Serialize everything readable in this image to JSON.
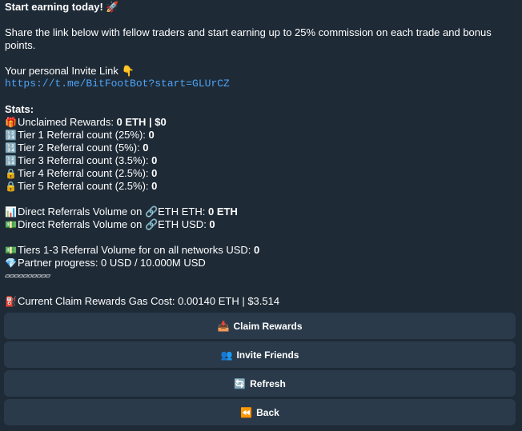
{
  "message": {
    "title": "Start earning today! 🚀",
    "intro": "Share the link below with fellow traders and start earning up to 25% commission on each trade and bonus points.",
    "invite_label": "Your personal Invite Link 👇",
    "invite_link": "https://t.me/BitFootBot?start=GLUrCZ",
    "stats_header": "Stats:",
    "unclaimed_label": "Unclaimed Rewards: ",
    "unclaimed_value": "0 ETH | $0",
    "tiers": [
      {
        "icon": "🔢",
        "label": "Tier 1 Referral count (25%): ",
        "value": "0"
      },
      {
        "icon": "🔢",
        "label": "Tier 2 Referral count (5%): ",
        "value": "0"
      },
      {
        "icon": "🔢",
        "label": "Tier 3 Referral count (3.5%): ",
        "value": "0"
      },
      {
        "icon": "🔒",
        "label": "Tier 4 Referral count (2.5%): ",
        "value": "0"
      },
      {
        "icon": "🔒",
        "label": "Tier 5 Referral count (2.5%): ",
        "value": "0"
      }
    ],
    "volume_eth_label": "Direct Referrals Volume on 🔗ETH ETH: ",
    "volume_eth_value": "0 ETH",
    "volume_usd_label": "Direct Referrals Volume on 🔗ETH USD: ",
    "volume_usd_value": "0",
    "tiers_volume_label": "Tiers 1-3 Referral Volume for on all networks USD: ",
    "tiers_volume_value": "0",
    "partner_progress": "Partner progress: 0 USD / 10.000M USD",
    "progress_bar": "▱▱▱▱▱▱▱▱▱▱",
    "gas_cost": "Current Claim Rewards Gas Cost: 0.00140 ETH | $3.514"
  },
  "icons": {
    "gift": "🎁",
    "chart": "📊",
    "money": "💵",
    "diamond": "💎",
    "fuel": "⛽",
    "inbox": "📥",
    "people": "👥",
    "refresh": "🔄",
    "back": "⏪"
  },
  "buttons": {
    "claim": "Claim Rewards",
    "invite": "Invite Friends",
    "refresh": "Refresh",
    "back": "Back"
  }
}
